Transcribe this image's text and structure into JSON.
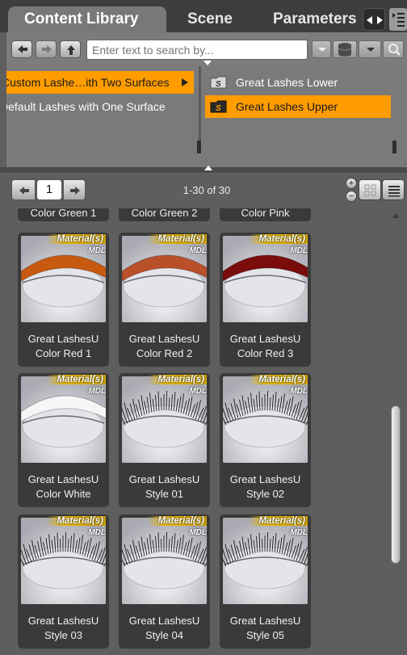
{
  "tabs": [
    {
      "label": "Content Library"
    },
    {
      "label": "Scene"
    },
    {
      "label": "Parameters"
    }
  ],
  "icons": {
    "nav_back": "arrow-left-icon",
    "nav_forward": "arrow-right-icon",
    "nav_up": "arrow-up-icon",
    "search_dropdown": "chevron-down-icon",
    "database": "database-icon",
    "search": "magnifier-icon",
    "folder": "smart-folder-icon"
  },
  "search": {
    "placeholder": "Enter text to search by..."
  },
  "left_list": [
    {
      "label": "Custom Lashe…ith Two Surfaces",
      "selected": true,
      "has_children": true
    },
    {
      "label": "Default Lashes with One Surface",
      "selected": false,
      "has_children": false
    }
  ],
  "right_list": [
    {
      "label": "Great Lashes Lower",
      "selected": false
    },
    {
      "label": "Great Lashes Upper",
      "selected": true
    }
  ],
  "pager": {
    "page": "1",
    "count": "1-30 of 30"
  },
  "colors": {
    "accent": "#ff9c00",
    "badge": "#e3b400"
  },
  "badge": {
    "label": "Material(s)",
    "sub": "MDL"
  },
  "partial_row": [
    "Color Green 1",
    "Color Green 2",
    "Color Pink"
  ],
  "items": [
    {
      "line1": "Great LashesU",
      "line2": "Color Red 1",
      "kind": "color",
      "color": "#c75a10"
    },
    {
      "line1": "Great LashesU",
      "line2": "Color Red 2",
      "kind": "color",
      "color": "#b9502a"
    },
    {
      "line1": "Great LashesU",
      "line2": "Color Red 3",
      "kind": "color",
      "color": "#7a0c0c"
    },
    {
      "line1": "Great LashesU",
      "line2": "Color White",
      "kind": "color",
      "color": "#f6f6f6"
    },
    {
      "line1": "Great LashesU",
      "line2": "Style 01",
      "kind": "style"
    },
    {
      "line1": "Great LashesU",
      "line2": "Style 02",
      "kind": "style"
    },
    {
      "line1": "Great LashesU",
      "line2": "Style 03",
      "kind": "style"
    },
    {
      "line1": "Great LashesU",
      "line2": "Style 04",
      "kind": "style"
    },
    {
      "line1": "Great LashesU",
      "line2": "Style 05",
      "kind": "style"
    }
  ]
}
